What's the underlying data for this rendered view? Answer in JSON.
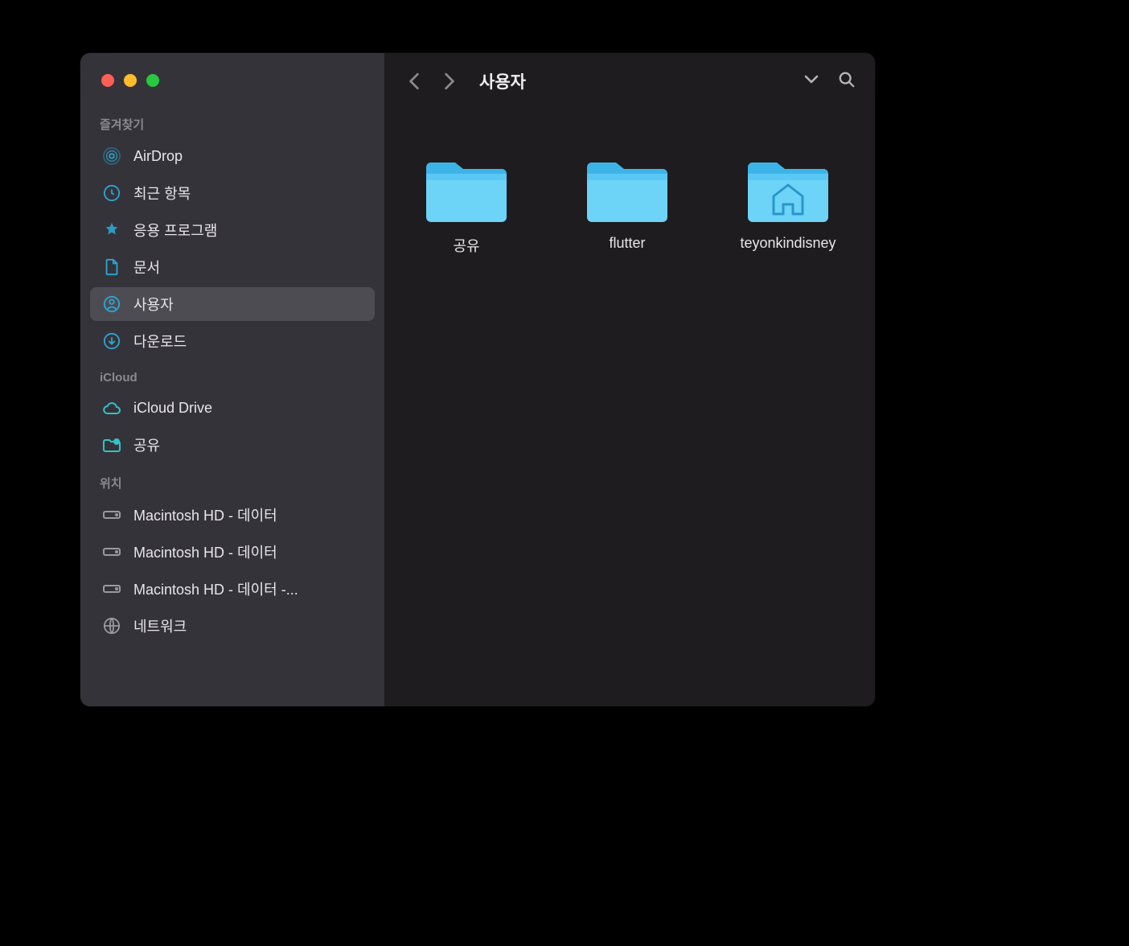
{
  "window": {
    "title": "사용자"
  },
  "colors": {
    "accent": "#2aa6d1",
    "folder": "#5ac8f5",
    "folderDark": "#3db4e8"
  },
  "sidebar": {
    "sections": {
      "favorites": {
        "header": "즐겨찾기",
        "items": [
          {
            "icon": "airdrop-icon",
            "label": "AirDrop"
          },
          {
            "icon": "clock-icon",
            "label": "최근 항목"
          },
          {
            "icon": "apps-icon",
            "label": "응용 프로그램"
          },
          {
            "icon": "document-icon",
            "label": "문서"
          },
          {
            "icon": "user-icon",
            "label": "사용자",
            "selected": true
          },
          {
            "icon": "download-icon",
            "label": "다운로드"
          }
        ]
      },
      "icloud": {
        "header": "iCloud",
        "items": [
          {
            "icon": "cloud-icon",
            "label": "iCloud Drive"
          },
          {
            "icon": "shared-folder-icon",
            "label": "공유"
          }
        ]
      },
      "locations": {
        "header": "위치",
        "items": [
          {
            "icon": "disk-icon",
            "label": "Macintosh HD - 데이터"
          },
          {
            "icon": "disk-icon",
            "label": "Macintosh HD - 데이터"
          },
          {
            "icon": "disk-icon",
            "label": "Macintosh HD - 데이터 -..."
          },
          {
            "icon": "network-icon",
            "label": "네트워크"
          }
        ]
      }
    }
  },
  "content": {
    "folders": [
      {
        "name": "공유",
        "type": "folder"
      },
      {
        "name": "flutter",
        "type": "folder"
      },
      {
        "name": "teyonkindisney",
        "type": "home-folder"
      }
    ]
  }
}
